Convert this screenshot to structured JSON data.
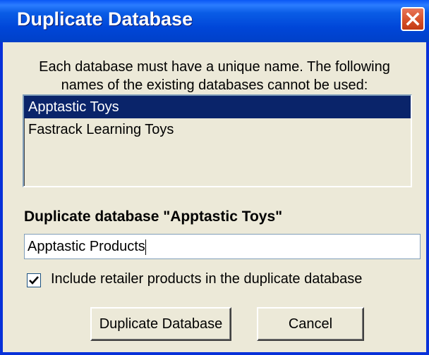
{
  "window": {
    "title": "Duplicate Database",
    "title_bar_color": "#0046d8",
    "close_icon": "close-icon"
  },
  "prompt": {
    "line1": "Each database must have a unique name. The following",
    "line2": "names of the existing databases cannot be used:"
  },
  "existing_databases": [
    {
      "name": "Apptastic Toys",
      "selected": true
    },
    {
      "name": "Fastrack Learning Toys",
      "selected": false
    }
  ],
  "duplicate_label": "Duplicate database \"Apptastic Toys\"",
  "new_name_value": "Apptastic Products",
  "include_retailer": {
    "label": "Include retailer products in the duplicate database",
    "checked": true
  },
  "buttons": {
    "duplicate": "Duplicate Database",
    "cancel": "Cancel"
  },
  "colors": {
    "selection_bg": "#0a246a",
    "dialog_bg": "#ece9d8"
  }
}
